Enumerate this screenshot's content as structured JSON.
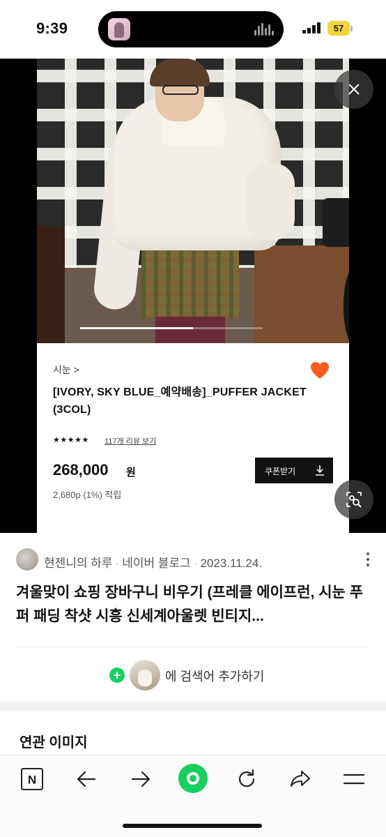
{
  "status_bar": {
    "time": "9:39",
    "battery": "57"
  },
  "viewer": {
    "brand": "시눈 >",
    "product_title": "[IVORY, SKY BLUE_예약배송]_PUFFER JACKET (3COL)",
    "stars": "★★★★★",
    "review_count": "117개 리뷰 보기",
    "price": "268,000",
    "price_unit": "원",
    "points": "2,680p (1%) 적립",
    "coupon_label": "쿠폰받기",
    "image_progress": 0.62,
    "heart_color": "#ff5a1f"
  },
  "source": {
    "author": "현젠니의 하루",
    "platform": "네이버 블로그",
    "date": "2023.11.24.",
    "post_title": "겨울맞이 쇼핑 장바구니 비우기 (프레클 에이프런, 시눈 푸퍼 패딩 착샷 시흥 신세계아울렛 빈티지..."
  },
  "add_search": {
    "text": "에 검색어 추가하기"
  },
  "related": {
    "title": "연관 이미지"
  },
  "toolbar": {
    "icons": [
      "naver-n-icon",
      "back-arrow-icon",
      "forward-arrow-icon",
      "green-home-dot-icon",
      "refresh-icon",
      "share-icon",
      "menu-icon"
    ],
    "accent": "#19ce60",
    "n_label": "N"
  }
}
